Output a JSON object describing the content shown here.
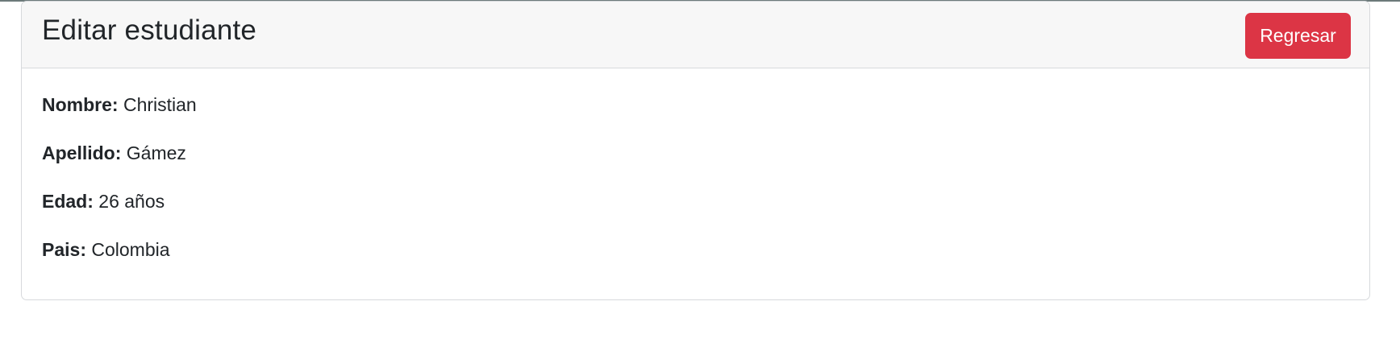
{
  "card": {
    "title": "Editar estudiante",
    "back_label": "Regresar"
  },
  "fields": [
    {
      "label": "Nombre:",
      "value": "Christian"
    },
    {
      "label": "Apellido:",
      "value": "Gámez"
    },
    {
      "label": "Edad:",
      "value": "26 años"
    },
    {
      "label": "Pais:",
      "value": "Colombia"
    }
  ],
  "colors": {
    "button_danger": "#dc3545",
    "header_bg": "#f7f7f7",
    "text": "#212529"
  }
}
